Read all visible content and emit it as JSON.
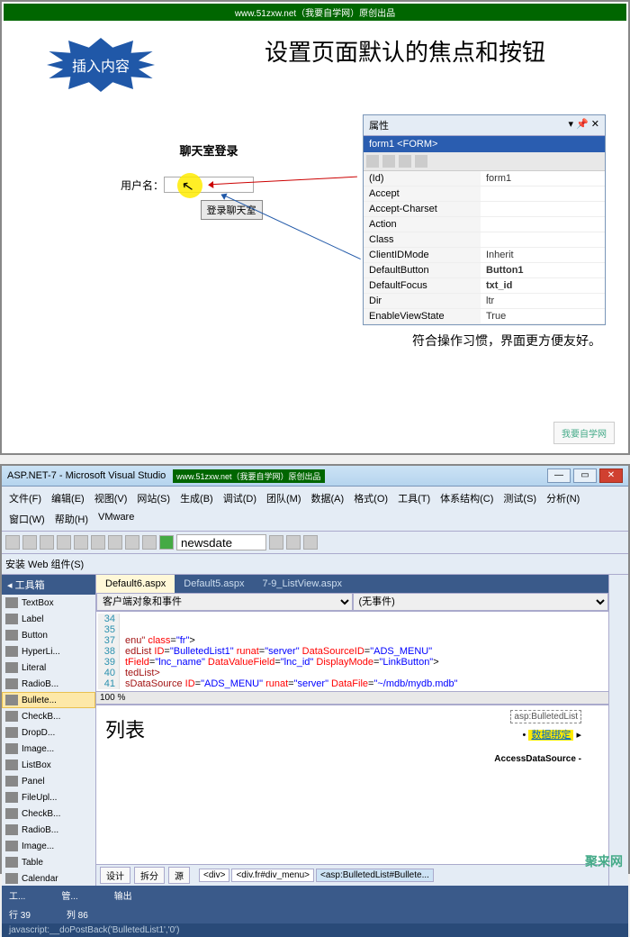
{
  "slide1": {
    "watermark": "www.51zxw.net（我要自学网）原创出品",
    "starburst": "插入内容",
    "title": "设置页面默认的焦点和按钮",
    "login_title": "聊天室登录",
    "username_label": "用户名：",
    "login_btn": "登录聊天室",
    "caption": "符合操作习惯，界面更方便友好。",
    "logo": "我要自学网"
  },
  "props": {
    "panel_title": "属性",
    "header": "form1 <FORM>",
    "rows": [
      {
        "k": "(Id)",
        "v": "form1",
        "bold": false
      },
      {
        "k": "Accept",
        "v": "",
        "bold": false
      },
      {
        "k": "Accept-Charset",
        "v": "",
        "bold": false
      },
      {
        "k": "Action",
        "v": "",
        "bold": false
      },
      {
        "k": "Class",
        "v": "",
        "bold": false
      },
      {
        "k": "ClientIDMode",
        "v": "Inherit",
        "bold": false
      },
      {
        "k": "DefaultButton",
        "v": "Button1",
        "bold": true
      },
      {
        "k": "DefaultFocus",
        "v": "txt_id",
        "bold": true
      },
      {
        "k": "Dir",
        "v": "ltr",
        "bold": false
      },
      {
        "k": "EnableViewState",
        "v": "True",
        "bold": false
      }
    ]
  },
  "ide": {
    "title": "ASP.NET-7 - Microsoft Visual Studio",
    "watermark": "www.51zxw.net（我要自学网）原创出品",
    "menu": [
      "文件(F)",
      "编辑(E)",
      "视图(V)",
      "网站(S)",
      "生成(B)",
      "调试(D)",
      "团队(M)",
      "数据(A)",
      "格式(O)",
      "工具(T)",
      "体系结构(C)",
      "测试(S)",
      "分析(N)",
      "窗口(W)",
      "帮助(H)",
      "VMware"
    ],
    "toolbar_input": "newsdate",
    "install_label": "安装 Web 组件(S)",
    "toolbox_title": "工具箱",
    "tools": [
      "TextBox",
      "Label",
      "Button",
      "HyperLi...",
      "Literal",
      "RadioB...",
      "Bullete...",
      "CheckB...",
      "DropD...",
      "Image...",
      "ListBox",
      "Panel",
      "FileUpl...",
      "CheckB...",
      "RadioB...",
      "Image...",
      "Table",
      "Calendar"
    ],
    "tabs": [
      {
        "label": "Default6.aspx",
        "active": true
      },
      {
        "label": "Default5.aspx",
        "active": false
      },
      {
        "label": "7-9_ListView.aspx",
        "active": false
      }
    ],
    "obj_left": "客户端对象和事件",
    "obj_right": "(无事件)",
    "code": [
      {
        "n": "34",
        "t": ""
      },
      {
        "n": "35",
        "t": ""
      },
      {
        "n": "37",
        "html": "<span class='tag'>enu\"</span> <span class='attr'>class</span>=<span class='val'>\"fr\"</span>&gt;"
      },
      {
        "n": "38",
        "html": "<span class='tag'>edList</span> <span class='attr'>ID</span>=<span class='val'>\"BulletedList1\"</span> <span class='attr'>runat</span>=<span class='val'>\"server\"</span> <span class='attr'>DataSourceID</span>=<span class='val'>\"ADS_MENU\"</span>"
      },
      {
        "n": "39",
        "html": "<span class='attr'>tField</span>=<span class='val'>\"lnc_name\"</span> <span class='attr'>DataValueField</span>=<span class='val'>\"lnc_id\"</span> <span class='attr'>DisplayMode</span>=<span class='val'>\"LinkButton\"</span>&gt;"
      },
      {
        "n": "40",
        "html": "<span class='tag'>tedList&gt;</span>"
      },
      {
        "n": "41",
        "html": "<span class='tag'>sDataSource</span> <span class='attr'>ID</span>=<span class='val'>\"ADS_MENU\"</span> <span class='attr'>runat</span>=<span class='val'>\"server\"</span> <span class='attr'>DataFile</span>=<span class='val'>\"~/mdb/mydb.mdb\"</span>"
      }
    ],
    "percent": "100 %",
    "designer_title": "列表",
    "smart_tag": "asp:BulletedList",
    "smart_link": "数据绑定",
    "ads_label": "AccessDataSource -",
    "bottom_tabs": [
      "设计",
      "拆分",
      "源"
    ],
    "breadcrumb": [
      "<div>",
      "<div.fr#div_menu>",
      "<asp:BulletedList#Bullete..."
    ],
    "panel_tab": "工...",
    "panel_tab2": "管...",
    "output_label": "输出",
    "status_js": "javascript:__doPostBack('BulletedList1','0')",
    "status_row": "行 39",
    "status_col": "列 86",
    "corner": "聚来网"
  }
}
